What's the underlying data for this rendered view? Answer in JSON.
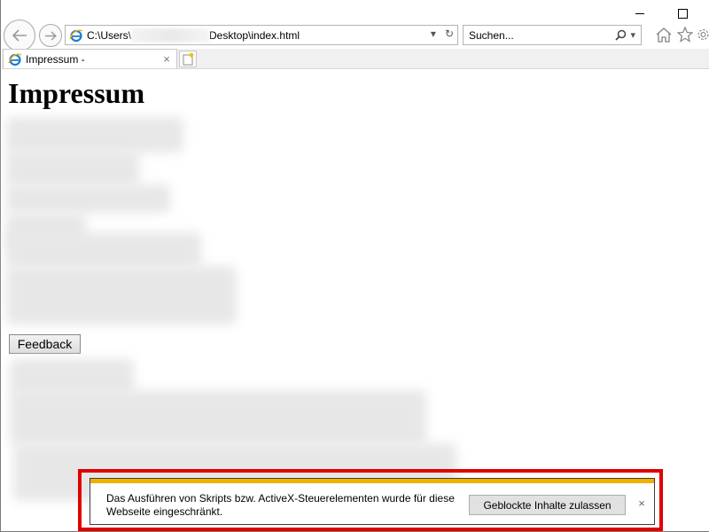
{
  "window": {
    "minimize_icon": "minimize-icon",
    "maximize_icon": "maximize-icon"
  },
  "navigation": {
    "back_icon": "arrow-left-icon",
    "forward_icon": "arrow-right-icon"
  },
  "address_bar": {
    "user_prefix": "C:\\Users\\",
    "path_suffix": "Desktop\\index.html",
    "dropdown_icon": "chevron-down-icon",
    "refresh_icon": "refresh-icon"
  },
  "search": {
    "placeholder": "Suchen...",
    "search_icon": "search-icon",
    "dropdown_icon": "chevron-down-icon"
  },
  "toolbar": {
    "home_icon": "home-icon",
    "favorites_icon": "star-icon",
    "settings_icon": "gear-icon"
  },
  "tabs": [
    {
      "label": "Impressum -",
      "active": true
    }
  ],
  "page": {
    "heading": "Impressum",
    "feedback_button": "Feedback"
  },
  "notification": {
    "message": "Das Ausführen von Skripts bzw. ActiveX-Steuerelementen wurde für diese Webseite eingeschränkt.",
    "allow_button": "Geblockte Inhalte zulassen",
    "close_glyph": "×",
    "stripe_color": "#f0b000"
  },
  "colors": {
    "highlight_border": "#e10000",
    "notification_stripe": "#f0b000"
  }
}
